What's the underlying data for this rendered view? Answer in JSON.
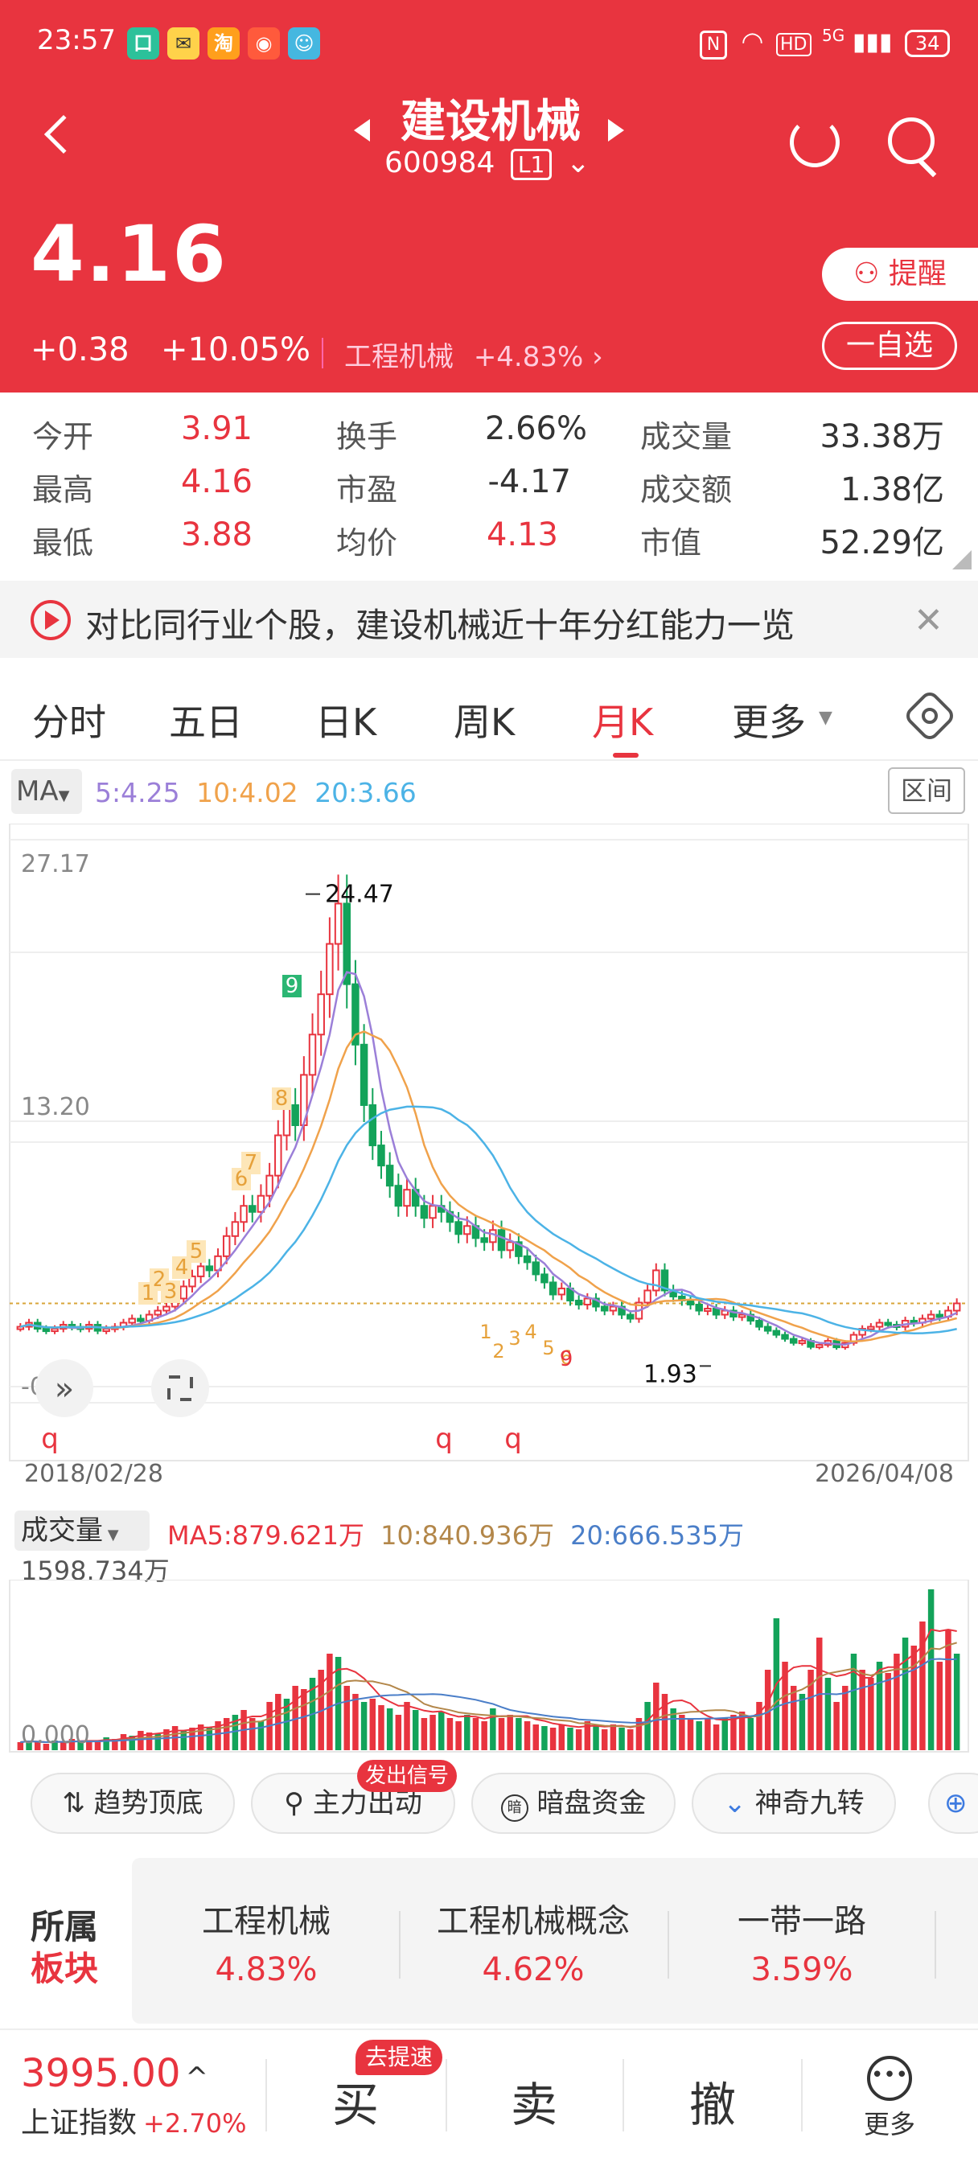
{
  "status_bar": {
    "time": "23:57",
    "net": "5G",
    "battery": "34",
    "hd": "HD"
  },
  "header": {
    "name": "建设机械",
    "code": "600984",
    "level": "L1"
  },
  "quote": {
    "price": "4.16",
    "change": "+0.38",
    "change_pct": "+10.05%",
    "sector": "工程机械",
    "sector_pct": "+4.83%",
    "remind_label": "提醒",
    "watch_label": "一自选"
  },
  "stats": {
    "open_label": "今开",
    "open": "3.91",
    "high_label": "最高",
    "high": "4.16",
    "low_label": "最低",
    "low": "3.88",
    "turnover_label": "换手",
    "turnover": "2.66%",
    "pe_label": "市盈",
    "pe": "-4.17",
    "avg_label": "均价",
    "avg": "4.13",
    "vol_label": "成交量",
    "vol": "33.38万",
    "amount_label": "成交额",
    "amount": "1.38亿",
    "mktcap_label": "市值",
    "mktcap": "52.29亿"
  },
  "banner": {
    "text": "对比同行业个股，建设机械近十年分红能力一览"
  },
  "tabs": [
    "分时",
    "五日",
    "日K",
    "周K",
    "月K",
    "更多"
  ],
  "active_tab": "月K",
  "ma": {
    "label": "MA",
    "ma5": "5:4.25",
    "ma10": "10:4.02",
    "ma20": "20:3.66",
    "range_btn": "区间",
    "color5": "#9b7fd8",
    "color10": "#f0a24b",
    "color20": "#4cb3e6"
  },
  "chart_data": [
    {
      "type": "candlestick",
      "y_axis_labels": [
        "27.17",
        "13.20",
        "-0.77"
      ],
      "ylim": [
        -0.77,
        27.17
      ],
      "max_label": "24.47",
      "min_label": "1.93",
      "x_start": "2018/02/28",
      "x_end": "2026/04/08",
      "nine_turn_markers": [
        "1",
        "2",
        "3",
        "4",
        "5",
        "6",
        "7",
        "8",
        "9"
      ]
    },
    {
      "type": "bar",
      "title": "成交量",
      "ma5": "MA5:879.621万",
      "ma10": "10:840.936万",
      "ma20": "20:666.535万",
      "max_label": "1598.734万",
      "min_label": "0.000"
    }
  ],
  "tools": [
    {
      "label": "趋势顶底"
    },
    {
      "label": "主力出动",
      "badge": "发出信号"
    },
    {
      "label": "暗盘资金",
      "icon_text": "暗"
    },
    {
      "label": "神奇九转"
    }
  ],
  "sectors": {
    "title_1": "所属",
    "title_2": "板块",
    "items": [
      {
        "name": "工程机械",
        "pct": "4.83%"
      },
      {
        "name": "工程机械概念",
        "pct": "4.62%"
      },
      {
        "name": "一带一路",
        "pct": "3.59%"
      }
    ]
  },
  "bottom": {
    "index_value": "3995.00",
    "index_name": "上证指数",
    "index_pct": "+2.70%",
    "buy": "买",
    "buy_badge": "去提速",
    "sell": "卖",
    "cancel": "撤",
    "more": "更多"
  }
}
